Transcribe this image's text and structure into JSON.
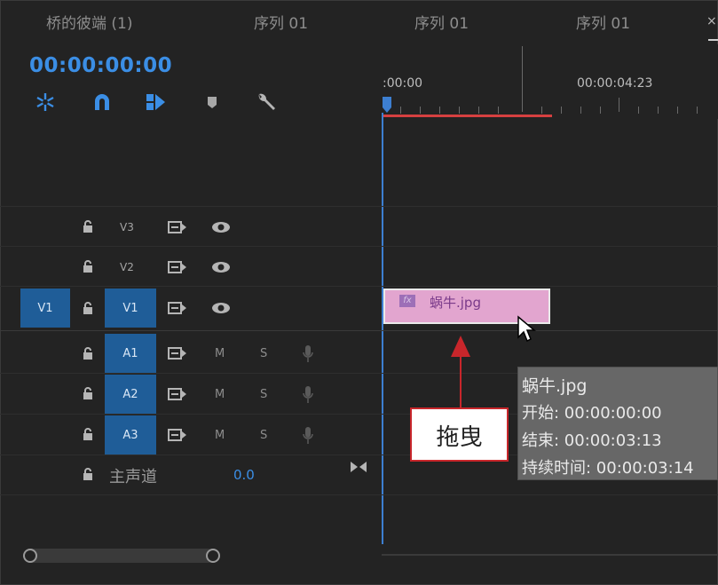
{
  "tabs": [
    {
      "label": "桥的彼端 (1)"
    },
    {
      "label": "序列 01"
    },
    {
      "label": "序列 01"
    },
    {
      "label": "序列 01"
    }
  ],
  "tab_close": "×",
  "timecode": "00:00:00:00",
  "toolbar": {
    "icons": [
      "snap-icon",
      "magnet-icon",
      "linked-selection-icon",
      "marker-icon",
      "wrench-icon"
    ]
  },
  "ruler": {
    "labels": [
      ":00:00",
      "00:00:04:23"
    ]
  },
  "tracks": {
    "video": [
      {
        "source": "",
        "name": "V3"
      },
      {
        "source": "",
        "name": "V2"
      },
      {
        "source": "V1",
        "name": "V1"
      }
    ],
    "audio": [
      {
        "name": "A1",
        "m": "M",
        "s": "S"
      },
      {
        "name": "A2",
        "m": "M",
        "s": "S"
      },
      {
        "name": "A3",
        "m": "M",
        "s": "S"
      }
    ],
    "master": {
      "label": "主声道",
      "value": "0.0"
    }
  },
  "clip": {
    "fx": "fx",
    "name": "蜗牛.jpg",
    "color": "#e2a5cf"
  },
  "tooltip": {
    "name": "蜗牛.jpg",
    "start": "开始: 00:00:00:00",
    "end": "结束: 00:00:03:13",
    "duration": "持续时间: 00:00:03:14"
  },
  "annotation": {
    "label": "拖曳",
    "color": "#c8262b"
  }
}
